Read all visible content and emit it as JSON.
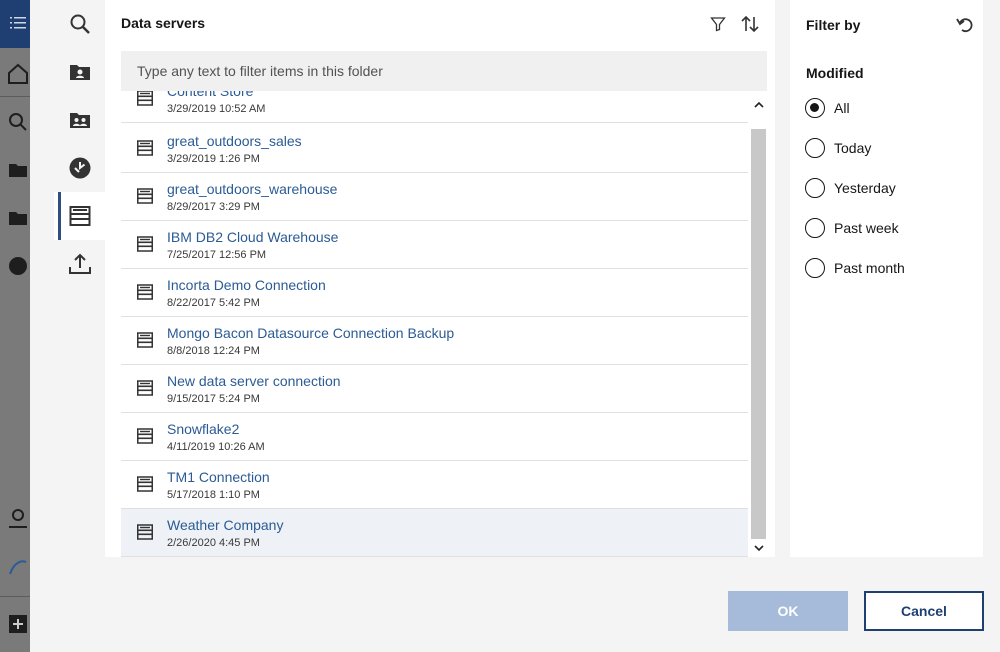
{
  "main": {
    "title": "Data servers",
    "search_placeholder": "Type any text to filter items in this folder",
    "items": [
      {
        "name": "Content Store",
        "date": "3/29/2019 10:52 AM"
      },
      {
        "name": "great_outdoors_sales",
        "date": "3/29/2019 1:26 PM"
      },
      {
        "name": "great_outdoors_warehouse",
        "date": "8/29/2017 3:29 PM"
      },
      {
        "name": "IBM DB2 Cloud Warehouse",
        "date": "7/25/2017 12:56 PM"
      },
      {
        "name": "Incorta Demo Connection",
        "date": "8/22/2017 5:42 PM"
      },
      {
        "name": "Mongo Bacon Datasource Connection Backup",
        "date": "8/8/2018 12:24 PM"
      },
      {
        "name": "New data server connection",
        "date": "9/15/2017 5:24 PM"
      },
      {
        "name": "Snowflake2",
        "date": "4/11/2019 10:26 AM"
      },
      {
        "name": "TM1 Connection",
        "date": "5/17/2018 1:10 PM"
      },
      {
        "name": "Weather Company",
        "date": "2/26/2020 4:45 PM"
      }
    ]
  },
  "filter": {
    "title": "Filter by",
    "section": "Modified",
    "options": [
      "All",
      "Today",
      "Yesterday",
      "Past week",
      "Past month"
    ],
    "selected": "All"
  },
  "footer": {
    "ok_label": "OK",
    "cancel_label": "Cancel"
  },
  "tabs": [
    "search-icon",
    "my-content-icon",
    "team-content-icon",
    "recent-icon",
    "data-servers-icon",
    "upload-icon"
  ],
  "colors": {
    "accent": "#1f3f73",
    "link": "#2b5b95",
    "ok_disabled": "#a5bbd9"
  }
}
